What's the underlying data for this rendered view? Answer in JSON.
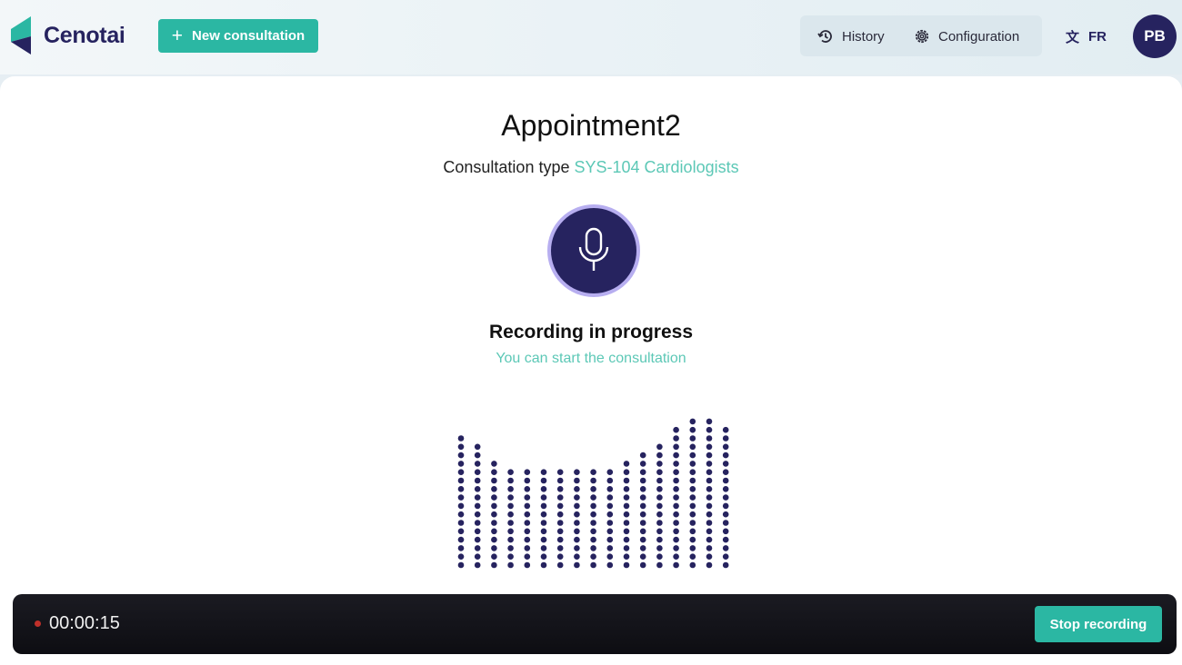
{
  "header": {
    "logo_text": "Cenotai",
    "new_consultation_label": "New consultation",
    "nav": {
      "history_label": "History",
      "configuration_label": "Configuration"
    },
    "language": "FR",
    "avatar_initials": "PB"
  },
  "main": {
    "title": "Appointment2",
    "consultation_type_label": "Consultation type",
    "consultation_type_value": "SYS-104 Cardiologists",
    "recording_title": "Recording in progress",
    "recording_subtitle": "You can start the consultation",
    "waveform_levels": [
      16,
      15,
      13,
      12,
      12,
      12,
      12,
      12,
      12,
      12,
      13,
      14,
      15,
      17,
      18,
      18,
      17
    ]
  },
  "bottom_bar": {
    "timer": "00:00:15",
    "stop_label": "Stop recording"
  },
  "colors": {
    "brand_navy": "#26235f",
    "accent_teal": "#2bb7a3",
    "recording_red": "#c0302a"
  },
  "icons": {
    "logo": "cenotai-logo-icon",
    "history": "history-icon",
    "configuration": "gear-icon",
    "language": "translate-icon",
    "microphone": "microphone-icon"
  }
}
